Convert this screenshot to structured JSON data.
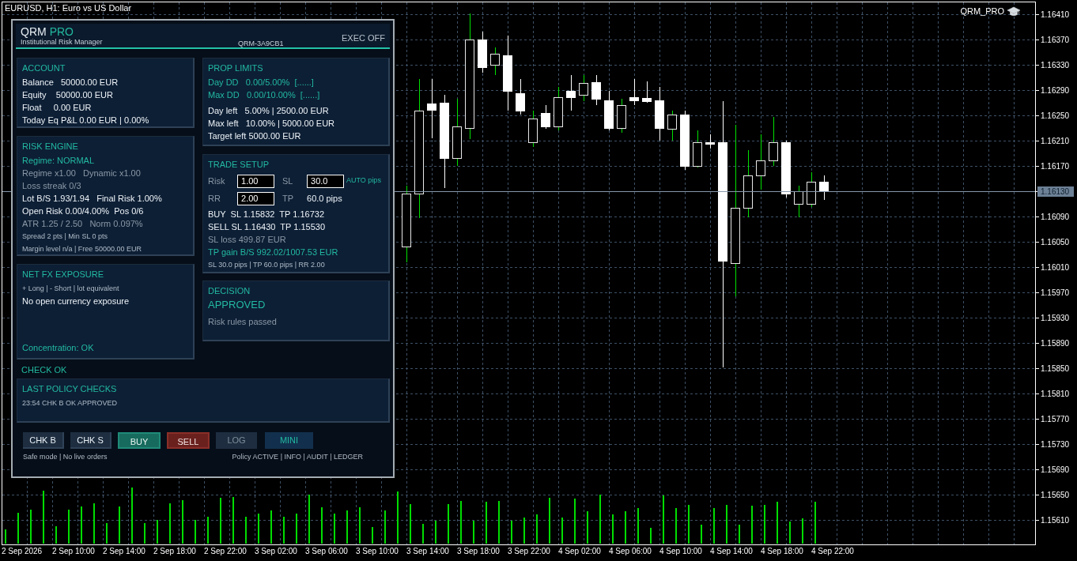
{
  "chart": {
    "title": "EURUSD, H1: Euro vs US Dollar",
    "indicator": "QRM_PRO",
    "price_axis": [
      {
        "text": "1.16410",
        "current": false
      },
      {
        "text": "1.16370",
        "current": false
      },
      {
        "text": "1.16330",
        "current": false
      },
      {
        "text": "1.16290",
        "current": false
      },
      {
        "text": "1.16250",
        "current": false
      },
      {
        "text": "1.16210",
        "current": false
      },
      {
        "text": "1.16170",
        "current": false
      },
      {
        "text": "1.16130",
        "current": true
      },
      {
        "text": "1.16090",
        "current": false
      },
      {
        "text": "1.16050",
        "current": false
      },
      {
        "text": "1.16010",
        "current": false
      },
      {
        "text": "1.15970",
        "current": false
      },
      {
        "text": "1.15930",
        "current": false
      },
      {
        "text": "1.15890",
        "current": false
      },
      {
        "text": "1.15850",
        "current": false
      },
      {
        "text": "1.15810",
        "current": false
      },
      {
        "text": "1.15770",
        "current": false
      },
      {
        "text": "1.15730",
        "current": false
      },
      {
        "text": "1.15690",
        "current": false
      },
      {
        "text": "1.15650",
        "current": false
      },
      {
        "text": "1.15610",
        "current": false
      }
    ],
    "time_axis": [
      "2 Sep 2026",
      "2 Sep 10:00",
      "2 Sep 14:00",
      "2 Sep 18:00",
      "2 Sep 22:00",
      "3 Sep 02:00",
      "3 Sep 06:00",
      "3 Sep 10:00",
      "3 Sep 14:00",
      "3 Sep 18:00",
      "3 Sep 22:00",
      "4 Sep 02:00",
      "4 Sep 06:00",
      "4 Sep 10:00",
      "4 Sep 14:00",
      "4 Sep 18:00",
      "4 Sep 22:00"
    ]
  },
  "panel": {
    "brand": "QRM",
    "brand_accent": "PRO",
    "subtitle": "Institutional Risk Manager",
    "instance_id": "QRM-3A9CB1",
    "exec_status": "EXEC OFF",
    "account": {
      "title": "ACCOUNT",
      "lines": [
        {
          "text": "Balance   50000.00 EUR",
          "kind": "normal"
        },
        {
          "text": "Equity    50000.00 EUR",
          "kind": "normal"
        },
        {
          "text": "Float     0.00 EUR",
          "kind": "normal"
        },
        {
          "text": "Today Eq P&L 0.00 EUR | 0.00%",
          "kind": "normal"
        }
      ]
    },
    "prop_limits": {
      "title": "PROP LIMITS",
      "drawdowns": [
        {
          "text": "Day DD   0.00/5.00%  [......]",
          "kind": "accent"
        },
        {
          "text": "Max DD   0.00/10.00%  [......]",
          "kind": "accent"
        }
      ],
      "remaining": [
        {
          "text": "Day left   5.00% | 2500.00 EUR",
          "kind": "normal"
        },
        {
          "text": "Max left   10.00% | 5000.00 EUR",
          "kind": "normal"
        },
        {
          "text": "Target left 5000.00 EUR",
          "kind": "normal"
        }
      ]
    },
    "risk_engine": {
      "title": "RISK ENGINE",
      "lines": [
        {
          "text": "Regime: NORMAL",
          "kind": "accent"
        },
        {
          "text": "Regime x1.00   Dynamic x1.00",
          "kind": "muted"
        },
        {
          "text": "Loss streak 0/3",
          "kind": "muted"
        },
        {
          "text": "Lot B/S 1.93/1.94   Final Risk 1.00%",
          "kind": "normal"
        },
        {
          "text": "Open Risk 0.00/4.00%  Pos 0/6",
          "kind": "normal"
        },
        {
          "text": "ATR 1.25 / 2.50   Norm 0.097%",
          "kind": "muted"
        },
        {
          "text": "Spread 2 pts | Min SL 0 pts",
          "kind": "small"
        },
        {
          "text": "Margin level n/a | Free 50000.00 EUR",
          "kind": "small"
        }
      ]
    },
    "trade_setup": {
      "title": "TRADE SETUP",
      "risk_label": "Risk",
      "risk_value": "1.00",
      "sl_label": "SL",
      "sl_value": "30.0",
      "sl_mode": "AUTO pips",
      "rr_label": "RR",
      "rr_value": "2.00",
      "tp_label": "TP",
      "tp_value": "60.0 pips",
      "lines": [
        {
          "text": "BUY  SL 1.15832  TP 1.16732",
          "kind": "normal"
        },
        {
          "text": "SELL SL 1.16430  TP 1.15530",
          "kind": "normal"
        },
        {
          "text": "SL loss 499.87 EUR",
          "kind": "muted"
        },
        {
          "text": "TP gain B/S 992.02/1007.53 EUR",
          "kind": "accent"
        },
        {
          "text": "SL 30.0 pips | TP 60.0 pips | RR 2.00",
          "kind": "small"
        }
      ]
    },
    "net_fx": {
      "title": "NET FX EXPOSURE",
      "legend": "+ Long | - Short | lot equivalent",
      "message": "No open currency exposure",
      "concentration": "Concentration: OK"
    },
    "decision": {
      "title": "DECISION",
      "verdict": "APPROVED",
      "reason": "Risk rules passed"
    },
    "check_status": "CHECK OK",
    "policy_checks": {
      "title": "LAST POLICY CHECKS",
      "entries": [
        "23:54 CHK B OK APPROVED"
      ]
    },
    "buttons": [
      {
        "label": "CHK B",
        "kind": "neutral"
      },
      {
        "label": "CHK S",
        "kind": "neutral"
      },
      {
        "label": "BUY",
        "kind": "buy"
      },
      {
        "label": "SELL",
        "kind": "sell"
      },
      {
        "label": "LOG",
        "kind": "dim"
      },
      {
        "label": "MINI",
        "kind": "toggle"
      }
    ],
    "footer_left": "Safe mode | No live orders",
    "footer_right": "Policy ACTIVE | INFO | AUDIT | LEDGER"
  }
}
